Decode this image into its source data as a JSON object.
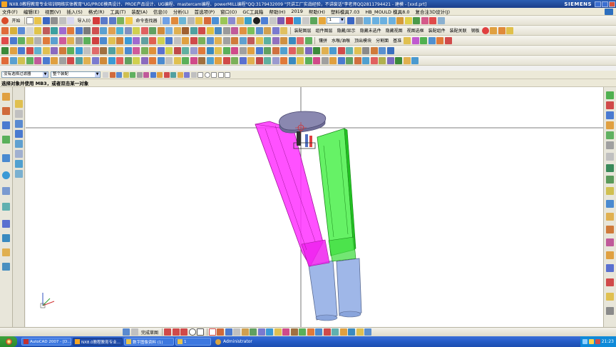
{
  "window": {
    "title": "NX8.0教程教育专业培训网络实体教育\"UG/PROE模具设计、PROE产品设计、UG编程、mastercam编程、powerMILL编程\"QQ:3179432009 \"只讲工厂实战经验，不讲废话\"李老师QQ2811794421 - 建模 - [xxd.prt]",
    "brand": "SIEMENS"
  },
  "menu": {
    "items": [
      "文件(F)",
      "编辑(E)",
      "视图(V)",
      "插入(S)",
      "格式(R)",
      "工具(T)",
      "装配(A)",
      "信息(I)",
      "分析(L)",
      "首选项(P)",
      "窗口(O)",
      "GC工具箱",
      "帮助(H)",
      "2019",
      "帮助(H)",
      "塑料模具7.03",
      "HB_MOULD 模具8.0",
      "复合注3D设计(J)"
    ]
  },
  "toolbar1": {
    "start_label": "开始",
    "import_label": "导入(I)",
    "cmd_finder_label": "命令查找器",
    "combo_value": "1"
  },
  "toolbar2": {
    "labels": [
      "装配图层",
      "组件图层",
      "隐藏/显示",
      "隐藏未选件",
      "隐藏视图",
      "视图选框",
      "装配组件",
      "装配关联",
      "钢板"
    ]
  },
  "toolbar3": {
    "labels": [
      "镶拼",
      "水喉/油喉",
      "顶出模块",
      "分割面",
      "基准"
    ]
  },
  "filterbar": {
    "filter_value": "没有选择过滤器",
    "assembly_value": "整个装配"
  },
  "cue": {
    "text": "选择对象并使用 MB3，或者双击某一对象"
  },
  "bottombar": {
    "label": "完成草图"
  },
  "taskbar": {
    "tasks": [
      "AutoCAD 2007 - [D...",
      "NX8.0教程教育专业...",
      "数字图像资料 (1)",
      "1"
    ],
    "user": "Administrator",
    "clock": "21:23"
  },
  "colors": {
    "magenta_body": "#ff33ff",
    "green_body": "#33ee33",
    "cylinder": "#9fb7e8",
    "top_plate": "#8a88b0",
    "titlebar": "#2d5fb3"
  }
}
